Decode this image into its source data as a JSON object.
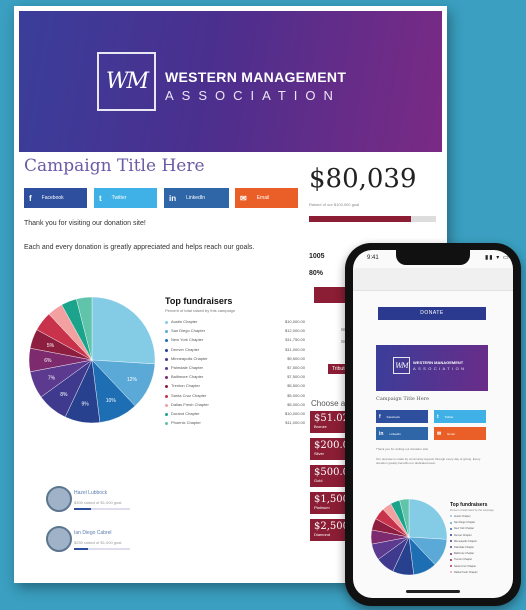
{
  "brand": {
    "mark": "WM",
    "line1": "WESTERN MANAGEMENT",
    "line2": "ASSOCIATION",
    "gradient_start": "#3a3e9a",
    "gradient_end": "#7a2a84"
  },
  "campaign": {
    "title": "Campaign Title Here",
    "share": [
      {
        "icon": "f",
        "label": "Facebook",
        "color": "#2d4f9e"
      },
      {
        "icon": "t",
        "label": "Twitter",
        "color": "#3fb1e6"
      },
      {
        "icon": "in",
        "label": "LinkedIn",
        "color": "#2f66a8"
      },
      {
        "icon": "✉",
        "label": "Email",
        "color": "#ea5e27"
      }
    ],
    "thanks": "Thank you for visiting our donation site!",
    "every": "Each and every donation is greatly appreciated and helps reach our goals."
  },
  "donation": {
    "amount": "$80,039",
    "goal_text": "Raised of our $100,000 goal",
    "progress": 0.8,
    "accent": "#8b1d35",
    "stat1": "1005",
    "stat2": "80%",
    "tribute": "Tribute",
    "choose": "Choose a"
  },
  "levels": [
    {
      "amount": "$51.02",
      "name": "Bronze"
    },
    {
      "amount": "$200.0",
      "name": "Silver"
    },
    {
      "amount": "$500.0",
      "name": "Gold"
    },
    {
      "amount": "$1,500.0",
      "name": "Platinum"
    },
    {
      "amount": "$2,500.0",
      "name": "Diamond"
    }
  ],
  "top_fundraisers": {
    "title": "Top fundraisers",
    "subtitle": "Percent of total raised by this campaign",
    "rows": [
      {
        "name": "Austin Chapter",
        "value": "$10,000.00",
        "color": "#84cce6"
      },
      {
        "name": "San Diego Chapter",
        "value": "$12,000.00",
        "color": "#5aa9d6"
      },
      {
        "name": "New York Chapter",
        "value": "$11,750.00",
        "color": "#1e6eb3"
      },
      {
        "name": "Denver Chapter",
        "value": "$11,000.00",
        "color": "#27418e"
      },
      {
        "name": "Minneapolis Chapter",
        "value": "$9,500.00",
        "color": "#3f3a8e"
      },
      {
        "name": "Palmdale Chapter",
        "value": "$7,500.00",
        "color": "#5b3a8f"
      },
      {
        "name": "Baltimore Chapter",
        "value": "$7,500.00",
        "color": "#7d2a6e"
      },
      {
        "name": "Trenton Chapter",
        "value": "$5,500.00",
        "color": "#8e1e3f"
      },
      {
        "name": "Santa Cruz Chapter",
        "value": "$5,000.00",
        "color": "#c8324b"
      },
      {
        "name": "Dallas Fresh Chapter",
        "value": "$5,000.00",
        "color": "#f2a0a0"
      },
      {
        "name": "Durand Chapter",
        "value": "$10,000.00",
        "color": "#1ba38c"
      },
      {
        "name": "Phoenix Chapter",
        "value": "$11,000.00",
        "color": "#5fc4a9"
      }
    ]
  },
  "chart_data": {
    "type": "pie",
    "title": "Top fundraisers",
    "labels": [
      "Austin Chapter",
      "San Diego Chapter",
      "New York Chapter",
      "Denver Chapter",
      "Minneapolis Chapter",
      "Palmdale Chapter",
      "Baltimore Chapter",
      "Trenton Chapter",
      "Santa Cruz Chapter",
      "Dallas Fresh Chapter",
      "Durand Chapter",
      "Phoenix Chapter"
    ],
    "values": [
      26,
      12,
      10,
      9,
      8,
      7,
      6,
      5,
      5,
      4,
      4,
      4
    ],
    "colors": [
      "#84cce6",
      "#5aa9d6",
      "#1e6eb3",
      "#27418e",
      "#3f3a8e",
      "#5b3a8f",
      "#7d2a6e",
      "#8e1e3f",
      "#c8324b",
      "#f2a0a0",
      "#1ba38c",
      "#5fc4a9"
    ],
    "slice_labels": [
      "",
      "12%",
      "10%",
      "9%",
      "8%",
      "7%",
      "6%",
      "5%",
      "",
      "",
      "",
      ""
    ]
  },
  "fundraisers": [
    {
      "name": "Hazel Lubbock",
      "sub": "$300 raised of $1,000 goal",
      "progress": 0.3
    },
    {
      "name": "Ian Diego Cabrel",
      "sub": "$250 raised of $1,000 goal",
      "progress": 0.25
    }
  ],
  "phone": {
    "time": "9:41",
    "status": "▮▮ ▾ ▭",
    "donate": "DONATE",
    "title": "Campaign Title Here",
    "thanks": "Thank you for visiting our donation site!",
    "every": "Our purpose is made by community support through every day of giving. Every donation greatly benefits our dedicated team.",
    "tf_title": "Top fundraisers",
    "tf_sub": "Percent of total raised by this campaign"
  }
}
